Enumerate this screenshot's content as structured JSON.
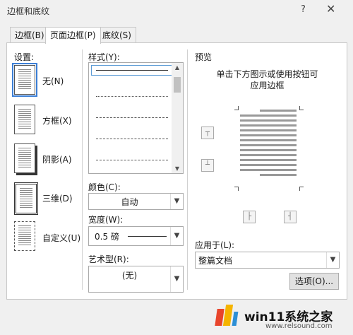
{
  "window": {
    "title": "边框和底纹",
    "help": "?",
    "close": "✕"
  },
  "tabs": [
    {
      "label": "边框(B)",
      "active": false
    },
    {
      "label": "页面边框(P)",
      "active": true
    },
    {
      "label": "底纹(S)",
      "active": false
    }
  ],
  "settings": {
    "heading": "设置:",
    "items": [
      {
        "label": "无(N)",
        "selected": true
      },
      {
        "label": "方框(X)",
        "selected": false
      },
      {
        "label": "阴影(A)",
        "selected": false
      },
      {
        "label": "三维(D)",
        "selected": false
      },
      {
        "label": "自定义(U)",
        "selected": false
      }
    ]
  },
  "style": {
    "heading": "样式(Y):"
  },
  "color": {
    "label": "颜色(C):",
    "value": "自动"
  },
  "width": {
    "label": "宽度(W):",
    "value": "0.5 磅"
  },
  "art": {
    "label": "艺术型(R):",
    "value": "(无)"
  },
  "preview": {
    "heading": "预览",
    "hint_line1": "单击下方图示或使用按钮可",
    "hint_line2": "应用边框"
  },
  "apply": {
    "label": "应用于(L):",
    "value": "整篇文档"
  },
  "options_button": "选项(O)...",
  "watermark": {
    "brand": "win11系统之家",
    "url": "www.relsound.com"
  },
  "colors": {
    "accent": "#3c7fd6",
    "logo_red": "#e8452c",
    "logo_yellow": "#f5b400"
  }
}
